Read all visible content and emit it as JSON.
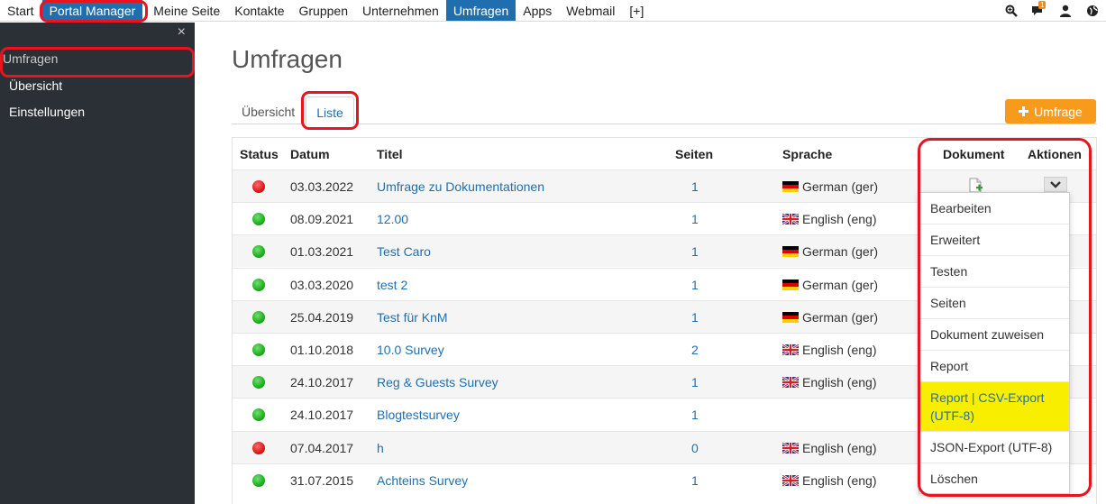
{
  "topnav": {
    "items": [
      "Start",
      "Portal Manager",
      "Meine Seite",
      "Kontakte",
      "Gruppen",
      "Unternehmen",
      "Umfragen",
      "Apps",
      "Webmail",
      "[+]"
    ],
    "active": "Umfragen",
    "notification_count": "1",
    "icons": [
      "search-zoom-icon",
      "chat-icon",
      "user-icon",
      "globe-icon"
    ]
  },
  "sidebar": {
    "close": "×",
    "section_title": "Umfragen",
    "links": [
      "Übersicht",
      "Einstellungen"
    ]
  },
  "main": {
    "title": "Umfragen",
    "tabs": [
      "Übersicht",
      "Liste"
    ],
    "active_tab": "Liste",
    "add_button": "Umfrage"
  },
  "table": {
    "headers": {
      "status": "Status",
      "datum": "Datum",
      "titel": "Titel",
      "seiten": "Seiten",
      "sprache": "Sprache",
      "dokument": "Dokument",
      "aktionen": "Aktionen"
    },
    "rows": [
      {
        "status": "red",
        "datum": "03.03.2022",
        "titel": "Umfrage zu Dokumentationen",
        "seiten": "1",
        "flag": "de",
        "sprache": "German (ger)"
      },
      {
        "status": "green",
        "datum": "08.09.2021",
        "titel": "12.00",
        "seiten": "1",
        "flag": "en",
        "sprache": "English (eng)"
      },
      {
        "status": "green",
        "datum": "01.03.2021",
        "titel": "Test Caro",
        "seiten": "1",
        "flag": "de",
        "sprache": "German (ger)"
      },
      {
        "status": "green",
        "datum": "03.03.2020",
        "titel": "test 2",
        "seiten": "1",
        "flag": "de",
        "sprache": "German (ger)"
      },
      {
        "status": "green",
        "datum": "25.04.2019",
        "titel": "Test für KnM",
        "seiten": "1",
        "flag": "de",
        "sprache": "German (ger)"
      },
      {
        "status": "green",
        "datum": "01.10.2018",
        "titel": "10.0 Survey",
        "seiten": "2",
        "flag": "en",
        "sprache": "English (eng)"
      },
      {
        "status": "green",
        "datum": "24.10.2017",
        "titel": "Reg & Guests Survey",
        "seiten": "1",
        "flag": "en",
        "sprache": "English (eng)"
      },
      {
        "status": "green",
        "datum": "24.10.2017",
        "titel": "Blogtestsurvey",
        "seiten": "1",
        "flag": "",
        "sprache": ""
      },
      {
        "status": "red",
        "datum": "07.04.2017",
        "titel": "h",
        "seiten": "0",
        "flag": "en",
        "sprache": "English (eng)"
      },
      {
        "status": "green",
        "datum": "31.07.2015",
        "titel": "Achteins Survey",
        "seiten": "1",
        "flag": "en",
        "sprache": "English (eng)"
      }
    ]
  },
  "actions_menu": {
    "items": [
      "Bearbeiten",
      "Erweitert",
      "Testen",
      "Seiten",
      "Dokument zuweisen",
      "Report",
      "Report | CSV-Export (UTF-8)",
      "JSON-Export (UTF-8)",
      "Löschen"
    ],
    "highlighted": "Report | CSV-Export (UTF-8)"
  },
  "colors": {
    "nav_active": "#1f6fb0",
    "sidebar_bg": "#2b2f36",
    "accent_orange": "#f89a1c",
    "annotation_red": "#e8141f",
    "highlight_yellow": "#f8ef00",
    "status_red": "#d81b1b",
    "status_green": "#1fae1f"
  }
}
